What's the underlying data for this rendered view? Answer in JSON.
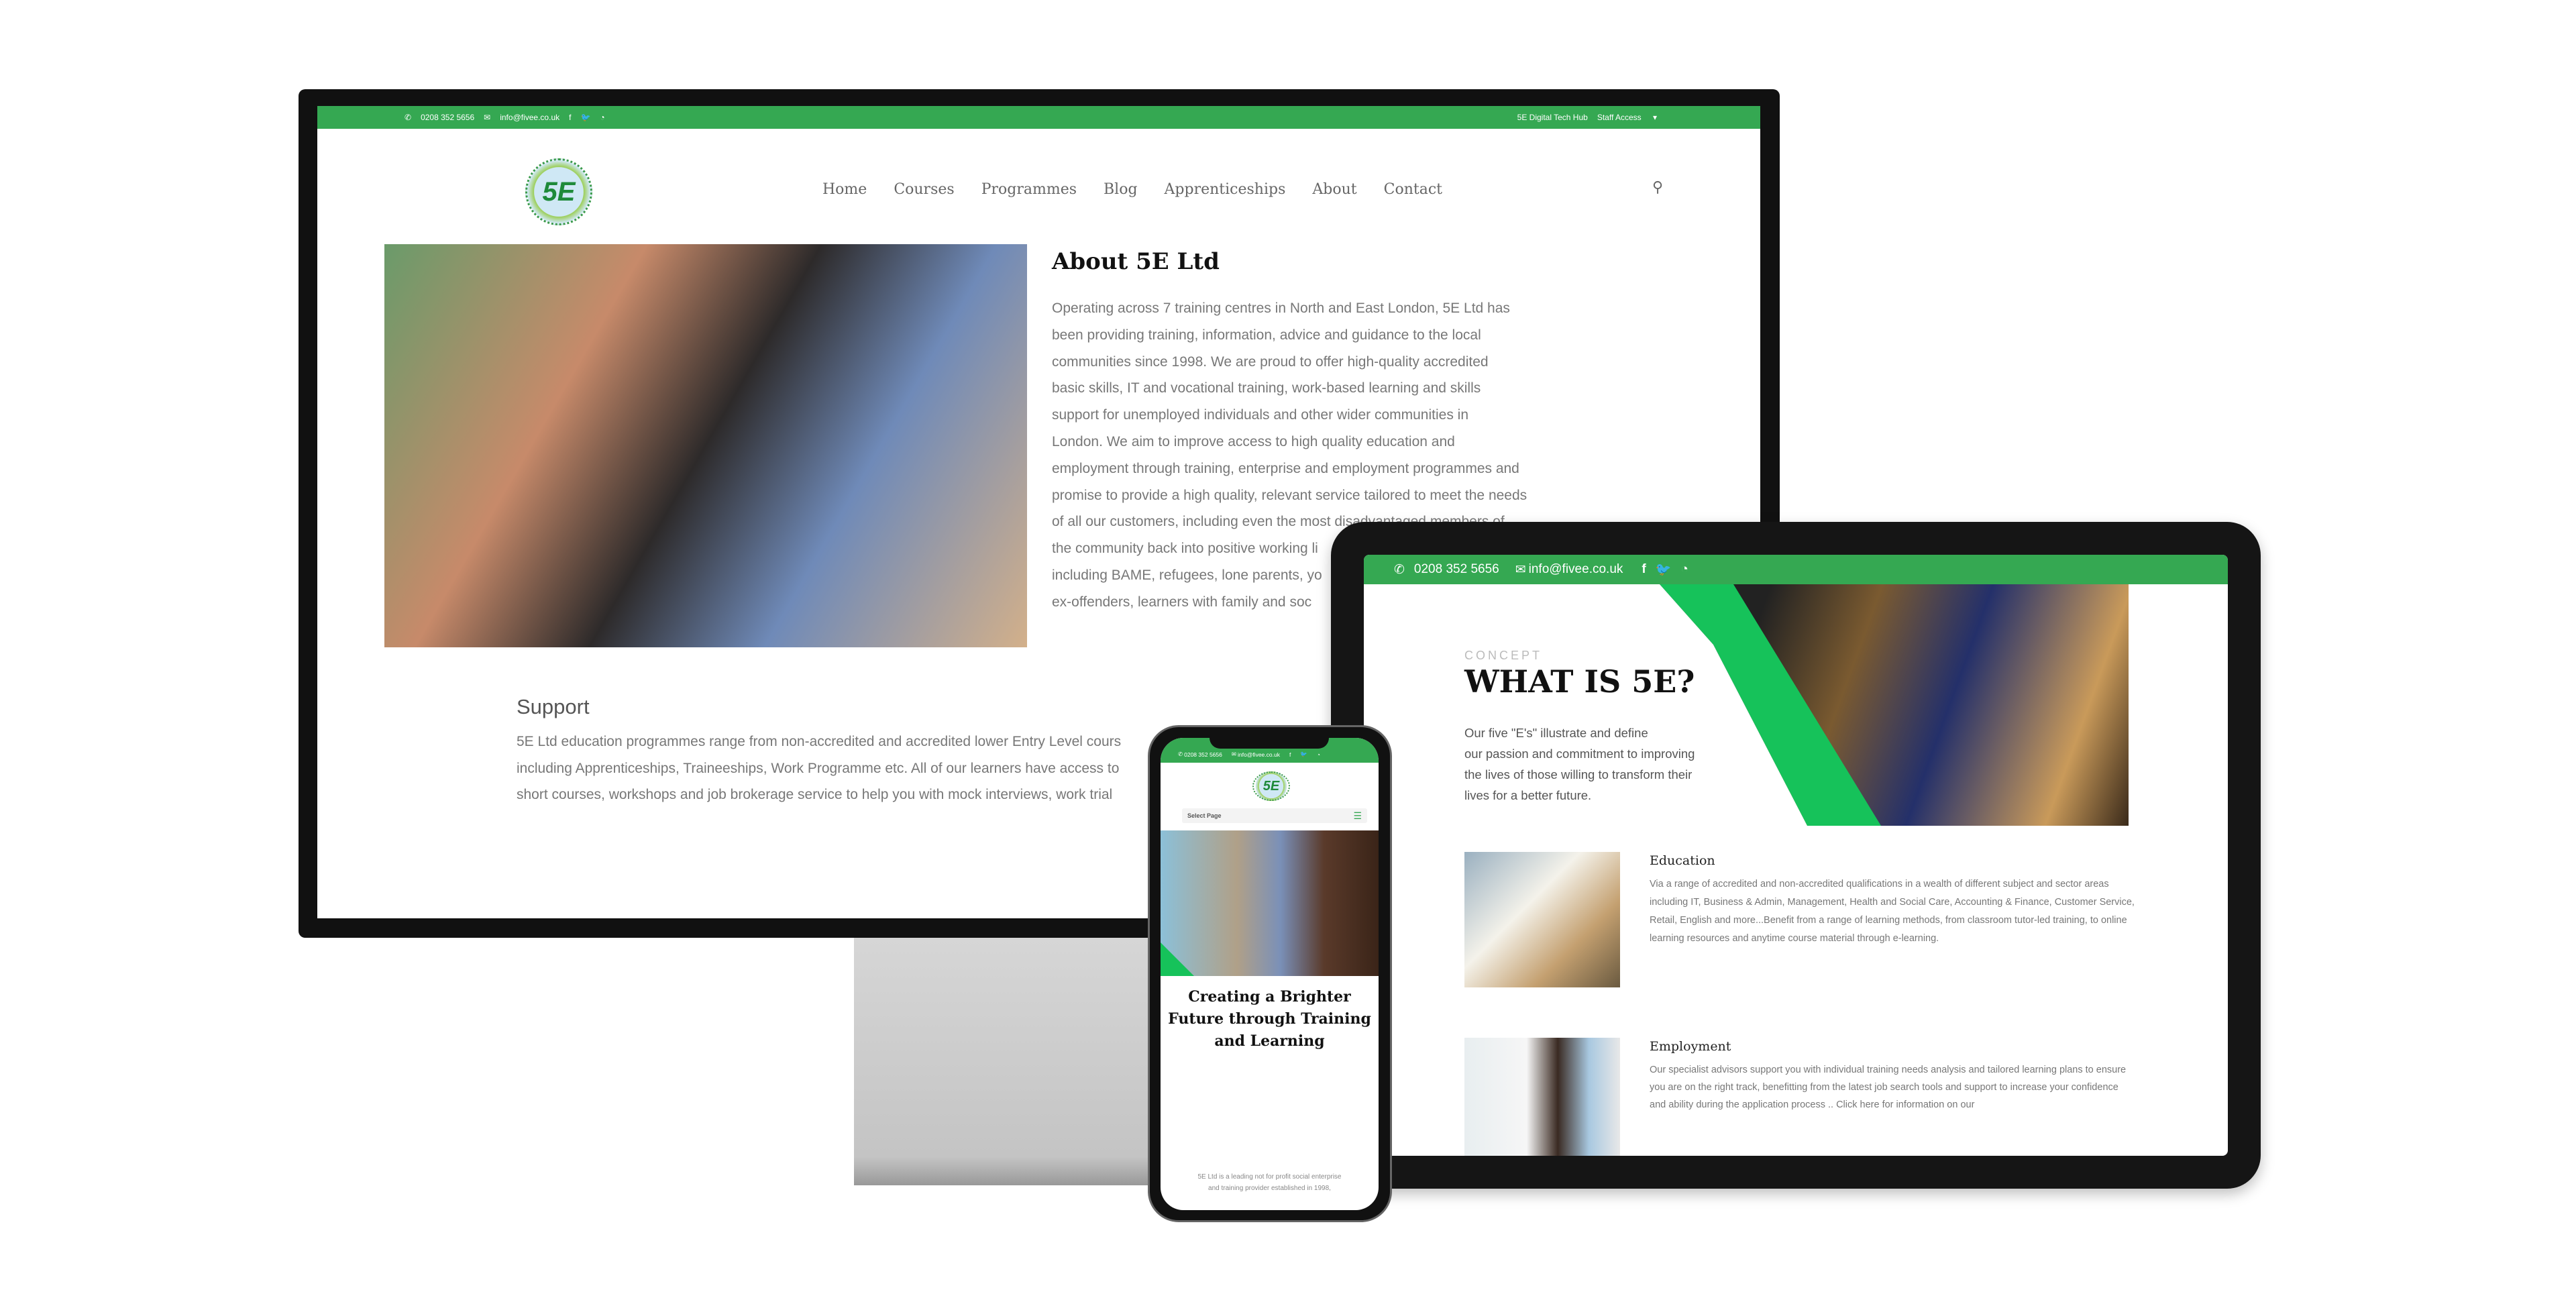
{
  "desktop": {
    "topbar": {
      "phone": "0208 352 5656",
      "email": "info@fivee.co.uk",
      "right_link": "5E Digital Tech Hub",
      "staff_access": "Staff Access"
    },
    "logo_text": "5E",
    "nav": [
      "Home",
      "Courses",
      "Programmes",
      "Blog",
      "Apprenticeships",
      "About",
      "Contact"
    ],
    "about": {
      "title": "About 5E Ltd",
      "lines": [
        "Operating across 7 training centres in North and East London, 5E Ltd has",
        "been providing training, information, advice and guidance to the local",
        "communities since 1998. We are proud to offer high-quality accredited",
        "basic skills, IT and vocational training, work-based learning and skills",
        "support for unemployed individuals and other wider communities in",
        "London. We aim to improve access to high quality education and",
        "employment through training, enterprise and employment programmes and",
        "promise to provide a high quality, relevant service tailored to meet the needs",
        "of all our customers, including even the most disadvantaged members of",
        "the community back into positive working li",
        "including BAME, refugees, lone parents, yo",
        "ex-offenders, learners with family and soc"
      ]
    },
    "support": {
      "title": "Support",
      "lines": [
        "5E Ltd education programmes range from non-accredited and accredited lower Entry Level cours",
        "including Apprenticeships, Traineeships, Work Programme etc. All of our learners have access to",
        "short courses, workshops and job brokerage service to help you with mock interviews, work trial"
      ]
    }
  },
  "tablet": {
    "topbar": {
      "phone": "0208 352 5656",
      "email": "info@fivee.co.uk"
    },
    "concept": "CONCEPT",
    "title": "WHAT IS 5E?",
    "intro": [
      "Our five \"E's\" illustrate and define",
      "our passion and commitment to improving",
      "the lives of those willing  to transform their",
      "lives for a better future."
    ],
    "education": {
      "title": "Education",
      "lines": [
        "Via a range of accredited and non-accredited qualifications in a wealth of different subject and sector areas",
        "including IT, Business & Admin, Management, Health and Social Care, Accounting & Finance, Customer Service,",
        "Retail, English and more...Benefit from a range of learning methods, from classroom tutor-led training, to online",
        "learning resources and anytime course material through e-learning."
      ]
    },
    "employment": {
      "title": "Employment",
      "lines": [
        "Our specialist advisors support you with individual training needs analysis and tailored learning plans to ensure",
        "you are on the right track, benefitting from the latest job search tools and support to increase your confidence",
        "and ability during the application process .. Click here for information on our"
      ]
    }
  },
  "phone": {
    "topbar": {
      "phone": "0208 352 5656",
      "email": "info@fivee.co.uk"
    },
    "logo_text": "5E",
    "select_page": "Select Page",
    "heading": [
      "Creating a Brighter",
      "Future through Training",
      "and Learning"
    ],
    "text": [
      "5E Ltd is a leading not for profit social enterprise",
      "and training provider established in 1998,"
    ]
  },
  "colors": {
    "brand_green": "#35a852",
    "accent_green": "#16c25a"
  },
  "icons": [
    "phone-icon",
    "mail-icon",
    "facebook-icon",
    "twitter-icon",
    "rss-icon",
    "search-icon",
    "hamburger-icon",
    "chevron-down-icon"
  ]
}
